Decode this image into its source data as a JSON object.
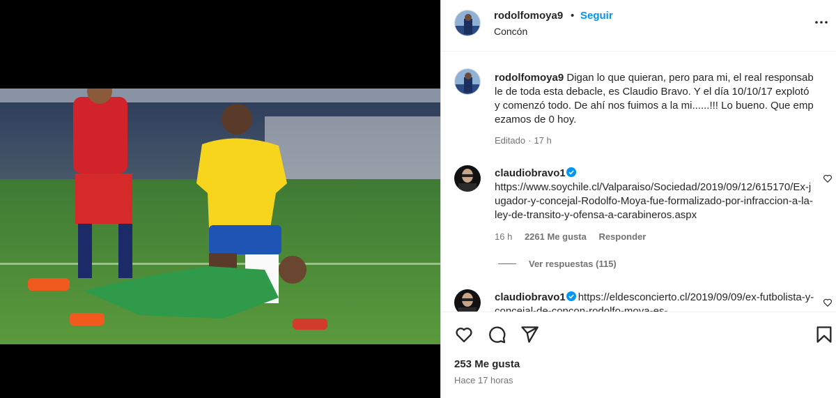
{
  "header": {
    "username": "rodolfomoya9",
    "dot": "•",
    "follow_label": "Seguir",
    "location": "Concón",
    "more_icon": "more-horizontal-icon"
  },
  "caption": {
    "username": "rodolfomoya9",
    "text": "Digan lo que quieran, pero para mi, el real responsable de toda esta debacle, es Claudio Bravo. Y el día 10/10/17 explotó y comenzó todo. De ahí nos fuimos a la mi......!!! Lo bueno. Que empezamos de 0 hoy.",
    "edited": "Editado",
    "sep": "·",
    "time": "17 h"
  },
  "comments": [
    {
      "username": "claudiobravo1",
      "verified": true,
      "text": "https://www.soychile.cl/Valparaiso/Sociedad/2019/09/12/615170/Ex-jugador-y-concejal-Rodolfo-Moya-fue-formalizado-por-infraccion-a-la-ley-de-transito-y-ofensa-a-carabineros.aspx",
      "time": "16 h",
      "likes": "2261 Me gusta",
      "reply_label": "Responder",
      "view_replies": "Ver respuestas (115)"
    },
    {
      "username": "claudiobravo1",
      "verified": true,
      "text": "https://eldesconcierto.cl/2019/09/09/ex-futbolista-y-concejal-de-concon-rodolfo-moya-es-"
    }
  ],
  "actions": {
    "like_icon": "heart-icon",
    "comment_icon": "comment-icon",
    "share_icon": "share-icon",
    "save_icon": "bookmark-icon",
    "likes": "253 Me gusta",
    "posted": "Hace 17 horas"
  },
  "colors": {
    "accent": "#0095f6",
    "verified": "#0095f6",
    "text": "#262626",
    "muted": "#737373"
  }
}
